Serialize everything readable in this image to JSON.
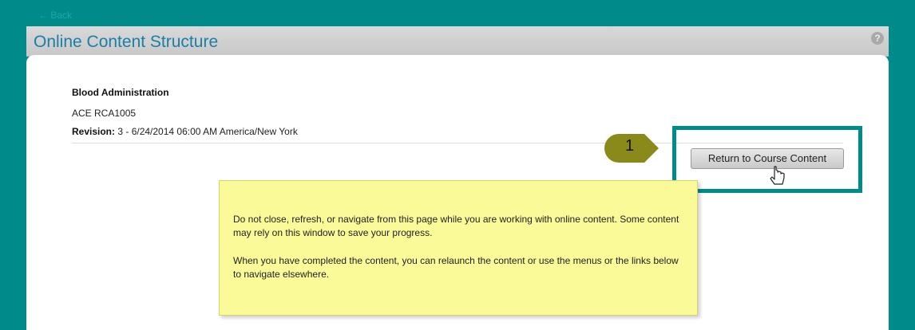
{
  "nav": {
    "back_label": "← Back"
  },
  "header": {
    "title": "Online Content Structure",
    "help_icon": "?"
  },
  "course": {
    "title": "Blood Administration",
    "code": "ACE RCA1005",
    "revision_label": "Revision:",
    "revision_value": " 3 - 6/24/2014 06:00 AM America/New York"
  },
  "actions": {
    "return_label": "Return to Course Content"
  },
  "callout": {
    "number": "1"
  },
  "notice": {
    "paragraph1": "Do not close, refresh, or navigate from this page while you are working with online content. Some content may rely on this window to save your progress.",
    "paragraph2": "When you have completed the content, you can relaunch the content or use the menus or the links below to navigate elsewhere."
  },
  "colors": {
    "background": "#008b8b",
    "title_text": "#1a7fa6",
    "callout": "#8a8a1a",
    "notice_background": "#fafa99"
  }
}
